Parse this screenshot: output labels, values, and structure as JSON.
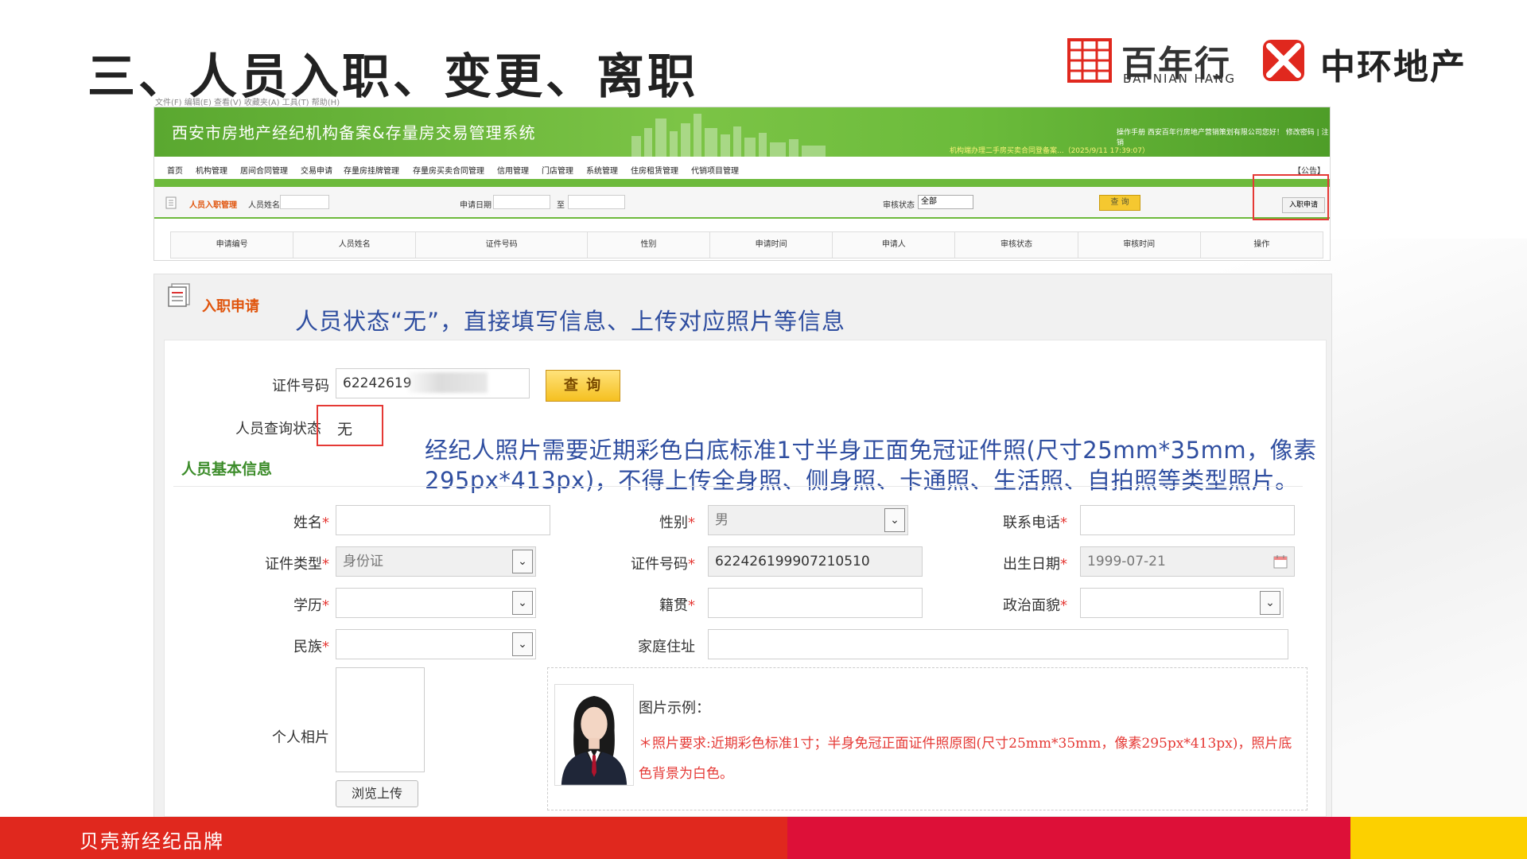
{
  "slide": {
    "title": "三、人员入职、变更、离职",
    "logos": {
      "bainianhang_cn": "百年行",
      "bainianhang_en": "BAI NIAN HANG",
      "zhonghuan_cn": "中环地产"
    },
    "footer_text": "贝壳新经纪品牌",
    "colors": {
      "footer_red": "#e0281e",
      "footer_crimson": "#dd1038",
      "footer_yellow": "#fcd000",
      "note_blue": "#2f4ea0",
      "highlight_red": "#e53935"
    }
  },
  "system_screenshot": {
    "menu_strip": "文件(F)  编辑(E)  查看(V)  收藏夹(A)  工具(T)  帮助(H)",
    "title": "西安市房地产经纪机构备案&存量房交易管理系统",
    "help_text": "操作手册     西安百年行房地产营销策划有限公司您好！ 修改密码 | 注销",
    "login_text": "机构端办理二手房买卖合同登备案...（2025/9/11 17:39:07）",
    "nav": [
      "首页",
      "机构管理",
      "居间合同管理",
      "交易申请",
      "存量房挂牌管理",
      "存量房买卖合同管理",
      "信用管理",
      "门店管理",
      "系统管理",
      "住房租赁管理",
      "代销项目管理"
    ],
    "announce": "【公告】",
    "filter": {
      "module_label": "人员入职管理",
      "name_label": "人员姓名",
      "date_label": "申请日期",
      "to_label": "至",
      "status_label": "审核状态",
      "status_value": "全部",
      "query_button": "查 询",
      "apply_button": "入职申请"
    },
    "table_headers": [
      "申请编号",
      "人员姓名",
      "证件号码",
      "性别",
      "申请时间",
      "申请人",
      "审核状态",
      "审核时间",
      "操作"
    ]
  },
  "form": {
    "title": "入职申请",
    "note_status": "人员状态“无”，直接填写信息、上传对应照片等信息",
    "id_label": "证件号码",
    "id_value": "62242619",
    "query_button": "查 询",
    "status_label": "人员查询状态",
    "status_value": "无",
    "basic_info": "人员基本信息",
    "note_photo": "经纪人照片需要近期彩色白底标准1寸半身正面免冠证件照(尺寸25mm*35mm，像素295px*413px)，不得上传全身照、侧身照、卡通照、生活照、自拍照等类型照片。",
    "fields": {
      "name_label": "姓名",
      "gender_label": "性别",
      "gender_value": "男",
      "phone_label": "联系电话",
      "idtype_label": "证件类型",
      "idtype_value": "身份证",
      "idno_label": "证件号码",
      "idno_value": "622426199907210510",
      "birth_label": "出生日期",
      "birth_value": "1999-07-21",
      "edu_label": "学历",
      "native_label": "籍贯",
      "political_label": "政治面貌",
      "ethnic_label": "民族",
      "address_label": "家庭住址",
      "photo_label": "个人相片",
      "upload_button": "浏览上传",
      "required_mark": "*"
    },
    "example_label": "图片示例：",
    "example_req": "＊照片要求:近期彩色标准1寸；半身免冠正面证件照原图(尺寸25mm*35mm，像素295px*413px)，照片底色背景为白色。"
  }
}
